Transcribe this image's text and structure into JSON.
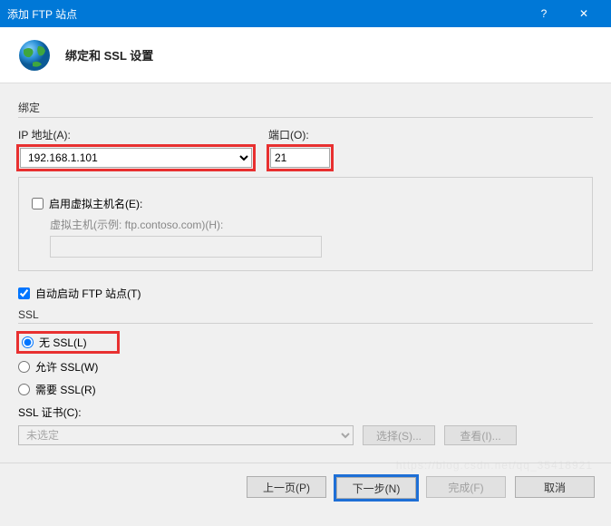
{
  "titlebar": {
    "title": "添加 FTP 站点"
  },
  "header": {
    "heading": "绑定和 SSL 设置"
  },
  "binding": {
    "section_label": "绑定",
    "ip_label": "IP 地址(A):",
    "ip_value": "192.168.1.101",
    "port_label": "端口(O):",
    "port_value": "21",
    "enable_vhost_label": "启用虚拟主机名(E):",
    "vhost_hint": "虚拟主机(示例: ftp.contoso.com)(H):"
  },
  "autostart": {
    "label": "自动启动 FTP 站点(T)"
  },
  "ssl": {
    "section_label": "SSL",
    "none": "无 SSL(L)",
    "allow": "允许 SSL(W)",
    "require": "需要 SSL(R)",
    "cert_label": "SSL 证书(C):",
    "cert_value": "未选定",
    "select_btn": "选择(S)...",
    "view_btn": "查看(I)..."
  },
  "footer": {
    "prev": "上一页(P)",
    "next": "下一步(N)",
    "finish": "完成(F)",
    "cancel": "取消"
  },
  "watermark": "https://blog.csdn.net/qq_35418921"
}
